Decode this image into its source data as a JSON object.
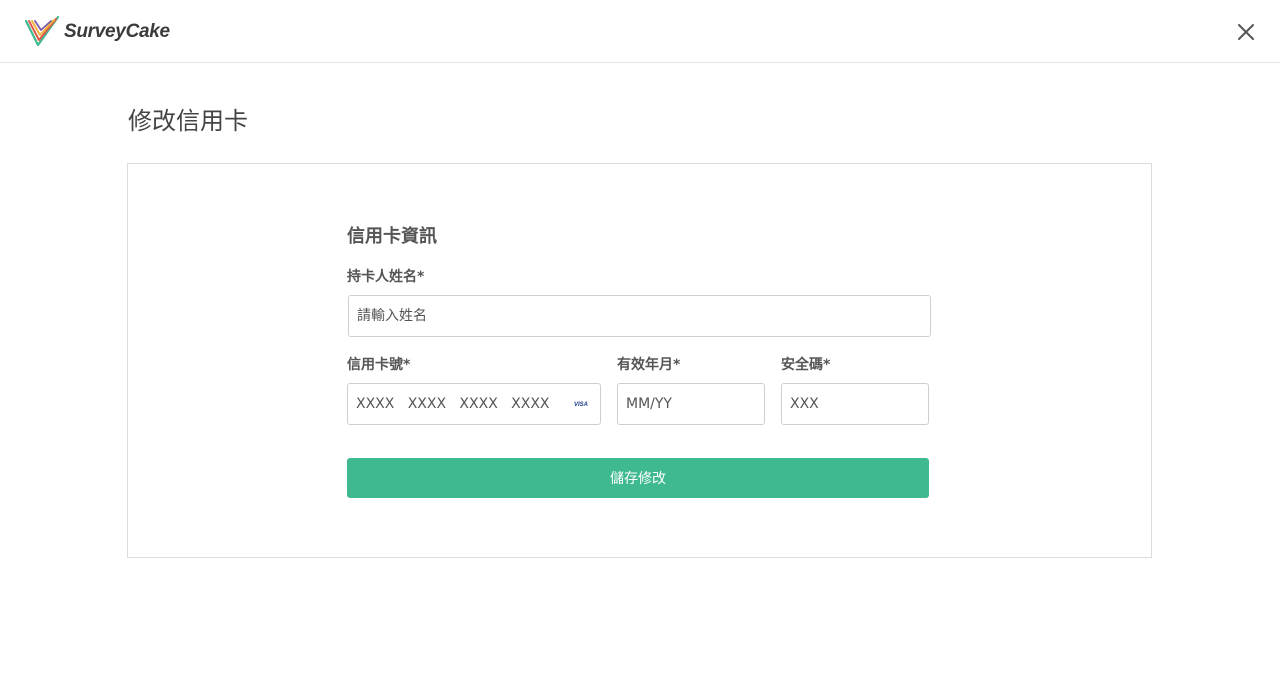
{
  "app": {
    "logo_text": "SurveyCake"
  },
  "header": {
    "close_icon": "close-icon"
  },
  "page": {
    "title": "修改信用卡"
  },
  "form": {
    "section_title": "信用卡資訊",
    "cardholder": {
      "label": "持卡人姓名*",
      "placeholder": "請輸入姓名"
    },
    "card_number": {
      "label": "信用卡號*",
      "placeholder": "XXXX   XXXX   XXXX   XXXX",
      "brand": "VISA"
    },
    "expiry": {
      "label": "有效年月*",
      "placeholder": "MM/YY"
    },
    "cvc": {
      "label": "安全碼*",
      "placeholder": "XXX"
    },
    "save_label": "儲存修改"
  },
  "colors": {
    "accent": "#3fb990",
    "border": "#cfcfcf",
    "card_border": "#dcdcdc"
  }
}
